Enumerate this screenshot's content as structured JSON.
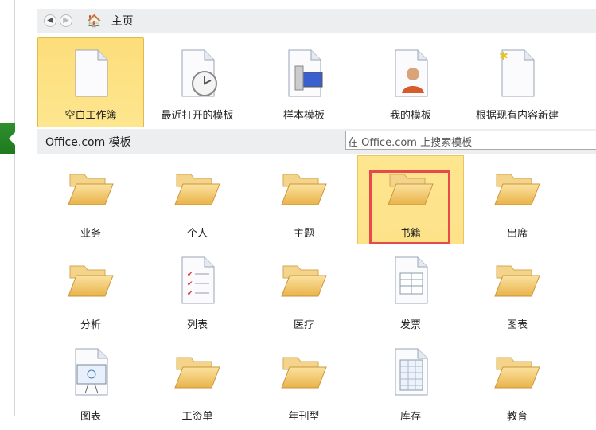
{
  "nav": {
    "back": "back",
    "forward": "forward",
    "breadcrumb": "主页"
  },
  "top_templates": [
    {
      "label": "空白工作簿",
      "icon": "blank-doc-icon",
      "selected": true
    },
    {
      "label": "最近打开的模板",
      "icon": "recent-clock-icon"
    },
    {
      "label": "样本模板",
      "icon": "sample-template-icon"
    },
    {
      "label": "我的模板",
      "icon": "my-template-icon"
    },
    {
      "label": "根据现有内容新建",
      "icon": "new-from-existing-icon"
    }
  ],
  "office_section": {
    "title": "Office.com 模板",
    "search_placeholder": "在 Office.com 上搜索模板"
  },
  "categories": [
    {
      "label": "业务",
      "icon": "folder"
    },
    {
      "label": "个人",
      "icon": "folder"
    },
    {
      "label": "主题",
      "icon": "folder"
    },
    {
      "label": "书籍",
      "icon": "folder",
      "selected": true
    },
    {
      "label": "出席",
      "icon": "folder"
    },
    {
      "label": "分析",
      "icon": "folder"
    },
    {
      "label": "列表",
      "icon": "checklist"
    },
    {
      "label": "医疗",
      "icon": "folder"
    },
    {
      "label": "发票",
      "icon": "invoice"
    },
    {
      "label": "图表",
      "icon": "folder"
    },
    {
      "label": "图表",
      "icon": "chart-board"
    },
    {
      "label": "工资单",
      "icon": "folder"
    },
    {
      "label": "年刊型",
      "icon": "folder"
    },
    {
      "label": "库存",
      "icon": "inventory"
    },
    {
      "label": "教育",
      "icon": "folder"
    }
  ],
  "colors": {
    "highlight": "#fde68f",
    "annotation": "#e84a4a",
    "accent": "#1d7a1d"
  }
}
